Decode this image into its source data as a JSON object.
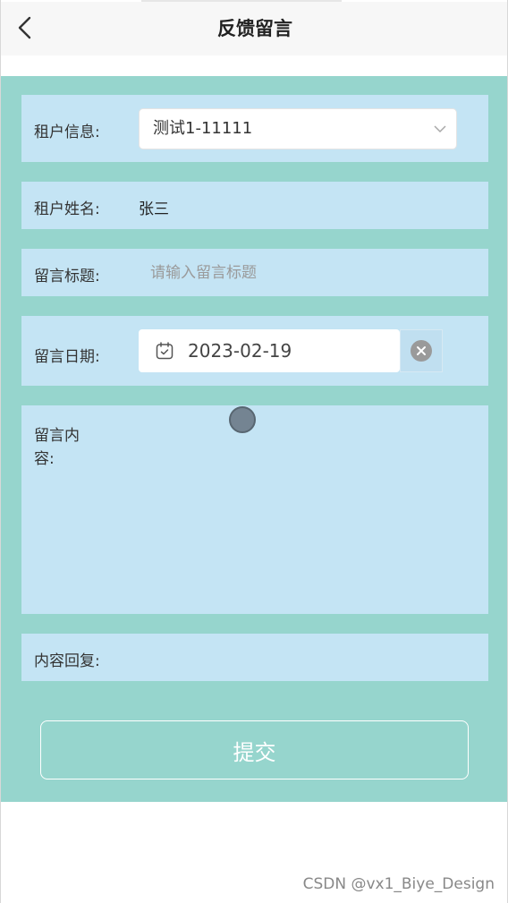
{
  "header": {
    "title": "反馈留言"
  },
  "form": {
    "tenant_info": {
      "label": "租户信息:",
      "selected": "测试1-11111"
    },
    "tenant_name": {
      "label": "租户姓名:",
      "value": "张三"
    },
    "message_title": {
      "label": "留言标题:",
      "placeholder": "请输入留言标题"
    },
    "message_date": {
      "label": "留言日期:",
      "value": "2023-02-19"
    },
    "message_content": {
      "label": "留言内容:"
    },
    "reply": {
      "label": "内容回复:"
    }
  },
  "actions": {
    "submit_label": "提交"
  },
  "watermark": "CSDN @vx1_Biye_Design",
  "colors": {
    "page_background": "#96d5cd",
    "row_background": "#c4e4f4",
    "header_background": "#f7f7f7"
  }
}
